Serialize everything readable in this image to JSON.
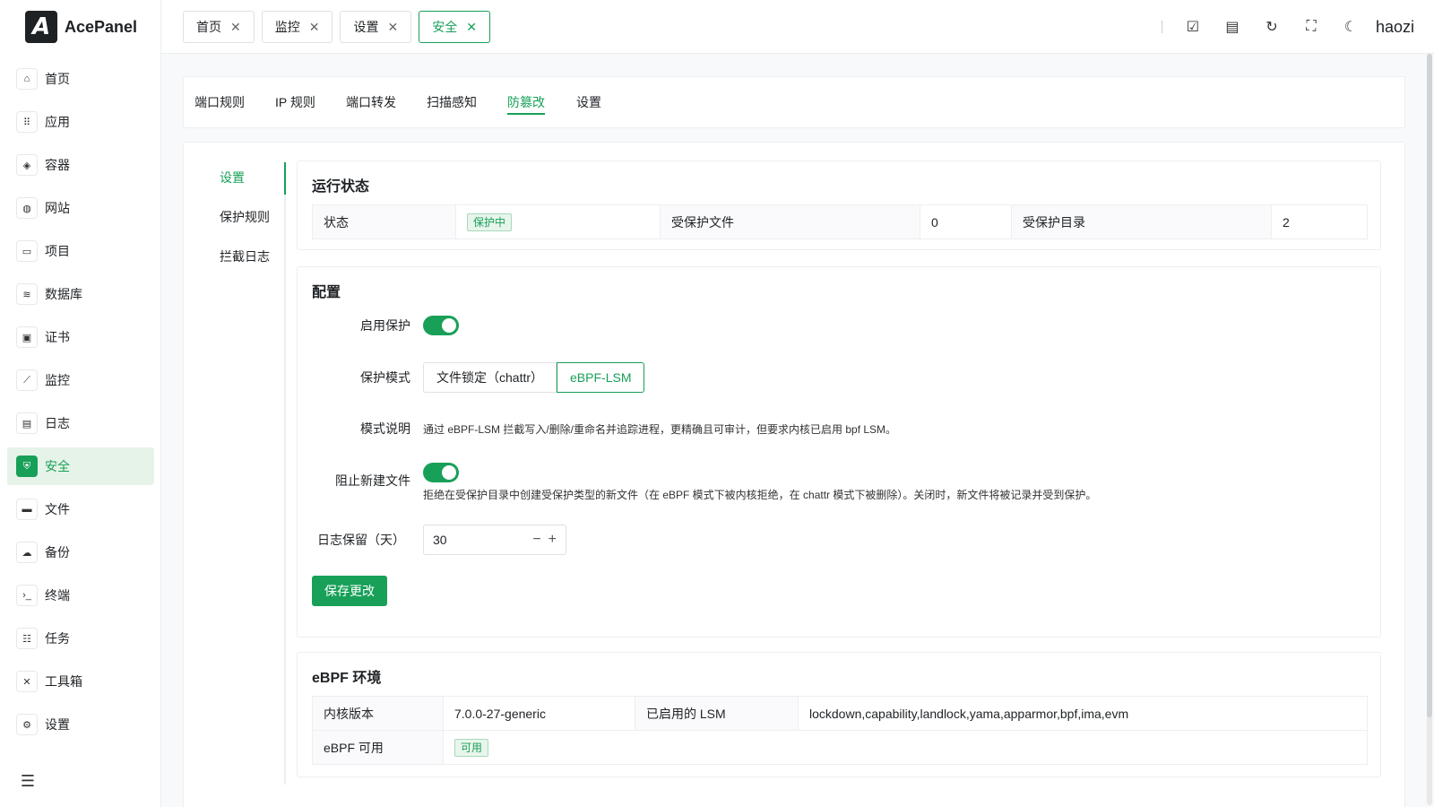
{
  "app": {
    "name": "AcePanel",
    "logo_letter": "A"
  },
  "sidebar": {
    "items": [
      {
        "label": "首页",
        "icon": "home-icon",
        "glyph": "⌂",
        "active": false
      },
      {
        "label": "应用",
        "icon": "apps-grid-icon",
        "glyph": "⠿",
        "active": false
      },
      {
        "label": "容器",
        "icon": "layers-icon",
        "glyph": "◈",
        "active": false
      },
      {
        "label": "网站",
        "icon": "globe-icon",
        "glyph": "◍",
        "active": false
      },
      {
        "label": "项目",
        "icon": "project-icon",
        "glyph": "▭",
        "active": false
      },
      {
        "label": "数据库",
        "icon": "database-icon",
        "glyph": "≋",
        "active": false
      },
      {
        "label": "证书",
        "icon": "certificate-icon",
        "glyph": "▣",
        "active": false
      },
      {
        "label": "监控",
        "icon": "chart-line-icon",
        "glyph": "⟋",
        "active": false
      },
      {
        "label": "日志",
        "icon": "log-file-icon",
        "glyph": "▤",
        "active": false
      },
      {
        "label": "安全",
        "icon": "shield-icon",
        "glyph": "⛨",
        "active": true
      },
      {
        "label": "文件",
        "icon": "folder-icon",
        "glyph": "▬",
        "active": false
      },
      {
        "label": "备份",
        "icon": "cloud-backup-icon",
        "glyph": "☁",
        "active": false
      },
      {
        "label": "终端",
        "icon": "terminal-icon",
        "glyph": "›_",
        "active": false
      },
      {
        "label": "任务",
        "icon": "task-icon",
        "glyph": "☷",
        "active": false
      },
      {
        "label": "工具箱",
        "icon": "tools-icon",
        "glyph": "✕",
        "active": false
      },
      {
        "label": "设置",
        "icon": "gear-icon",
        "glyph": "⚙",
        "active": false
      }
    ],
    "collapse_glyph": "☰"
  },
  "topbar": {
    "tabs": [
      {
        "label": "首页",
        "active": false
      },
      {
        "label": "监控",
        "active": false
      },
      {
        "label": "设置",
        "active": false
      },
      {
        "label": "安全",
        "active": true
      }
    ],
    "close_glyph": "✕",
    "tools": [
      {
        "icon": "checkbox-icon",
        "glyph": "☑"
      },
      {
        "icon": "document-icon",
        "glyph": "▤"
      },
      {
        "icon": "refresh-icon",
        "glyph": "↻"
      },
      {
        "icon": "fullscreen-icon",
        "glyph": "⛶"
      },
      {
        "icon": "moon-icon",
        "glyph": "☾"
      }
    ],
    "username": "haozi"
  },
  "section_tabs": [
    {
      "label": "端口规则",
      "active": false
    },
    {
      "label": "IP 规则",
      "active": false
    },
    {
      "label": "端口转发",
      "active": false
    },
    {
      "label": "扫描感知",
      "active": false
    },
    {
      "label": "防篡改",
      "active": true
    },
    {
      "label": "设置",
      "active": false
    }
  ],
  "side_menu": [
    {
      "label": "设置",
      "active": true
    },
    {
      "label": "保护规则",
      "active": false
    },
    {
      "label": "拦截日志",
      "active": false
    }
  ],
  "status_panel": {
    "title": "运行状态",
    "status_label": "状态",
    "status_value": "保护中",
    "files_label": "受保护文件",
    "files_value": "0",
    "dirs_label": "受保护目录",
    "dirs_value": "2"
  },
  "config_panel": {
    "title": "配置",
    "enable_label": "启用保护",
    "enable_on": true,
    "mode_label": "保护模式",
    "mode_options": [
      "文件锁定（chattr）",
      "eBPF-LSM"
    ],
    "mode_selected": "eBPF-LSM",
    "mode_desc_label": "模式说明",
    "mode_desc": "通过 eBPF-LSM 拦截写入/删除/重命名并追踪进程，更精确且可审计，但要求内核已启用 bpf LSM。",
    "block_new_label": "阻止新建文件",
    "block_new_on": true,
    "block_new_desc": "拒绝在受保护目录中创建受保护类型的新文件（在 eBPF 模式下被内核拒绝，在 chattr 模式下被删除）。关闭时，新文件将被记录并受到保护。",
    "log_keep_label": "日志保留（天）",
    "log_keep_value": "30",
    "minus_glyph": "−",
    "plus_glyph": "+",
    "save_label": "保存更改"
  },
  "ebpf_panel": {
    "title": "eBPF 环境",
    "kernel_label": "内核版本",
    "kernel_value": "7.0.0-27-generic",
    "lsm_label": "已启用的 LSM",
    "lsm_value": "lockdown,capability,landlock,yama,apparmor,bpf,ima,evm",
    "available_label": "eBPF 可用",
    "available_value": "可用"
  },
  "colors": {
    "accent": "#18a058",
    "accent_bg": "#e6f3e9"
  }
}
